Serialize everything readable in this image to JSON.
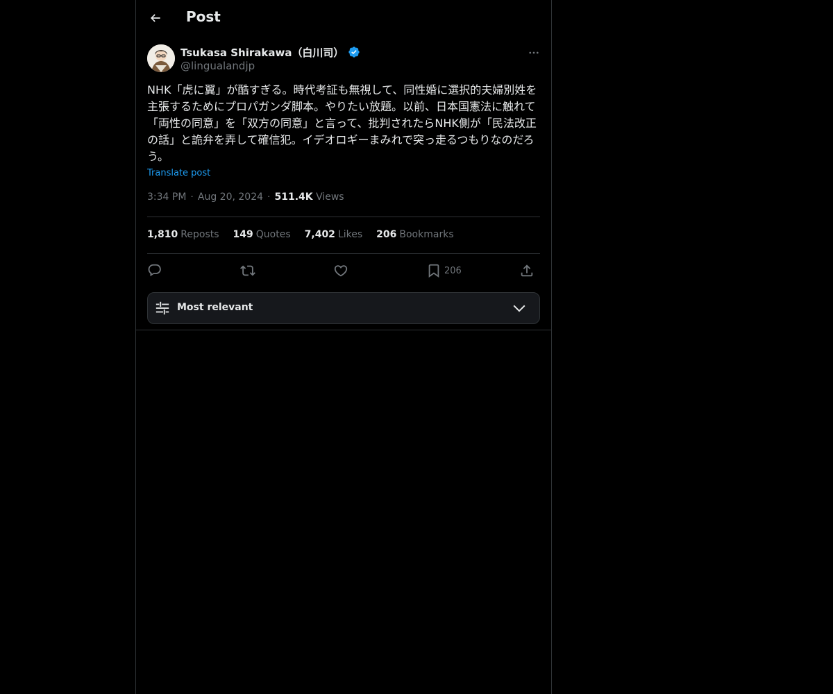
{
  "header": {
    "title": "Post",
    "back_icon": "arrow-left-icon"
  },
  "author": {
    "display_name": "Tsukasa Shirakawa（白川司）",
    "handle": "@lingualandjp",
    "verified_icon": "verified-badge-icon",
    "verified_color": "#1d9bf0",
    "avatar_icon": "avatar"
  },
  "post": {
    "text": "NHK「虎に翼」が酷すぎる。時代考証も無視して、同性婚に選択的夫婦別姓を主張するためにプロパガンダ脚本。やりたい放題。以前、日本国憲法に触れて「両性の同意」を「双方の同意」と言って、批判されたらNHK側が「民法改正の話」と詭弁を弄して確信犯。イデオロギーまみれで突っ走るつもりなのだろう。",
    "translate_label": "Translate post",
    "time": "3:34 PM",
    "date": "Aug 20, 2024",
    "views_count": "511.4K",
    "views_label": "Views",
    "separator": "·"
  },
  "stats": {
    "reposts_count": "1,810",
    "reposts_label": "Reposts",
    "quotes_count": "149",
    "quotes_label": "Quotes",
    "likes_count": "7,402",
    "likes_label": "Likes",
    "bookmarks_count": "206",
    "bookmarks_label": "Bookmarks"
  },
  "actions": {
    "reply_icon": "reply-icon",
    "repost_icon": "repost-icon",
    "like_icon": "heart-icon",
    "bookmark_icon": "bookmark-icon",
    "bookmark_count": "206",
    "share_icon": "share-icon"
  },
  "replies_sort": {
    "label": "Most relevant",
    "icon": "sliders-icon",
    "chevron": "chevron-down-icon"
  },
  "colors": {
    "background": "#000000",
    "text_primary": "#e7e9ea",
    "text_secondary": "#71767b",
    "accent": "#1d9bf0",
    "border": "#2f3336"
  }
}
